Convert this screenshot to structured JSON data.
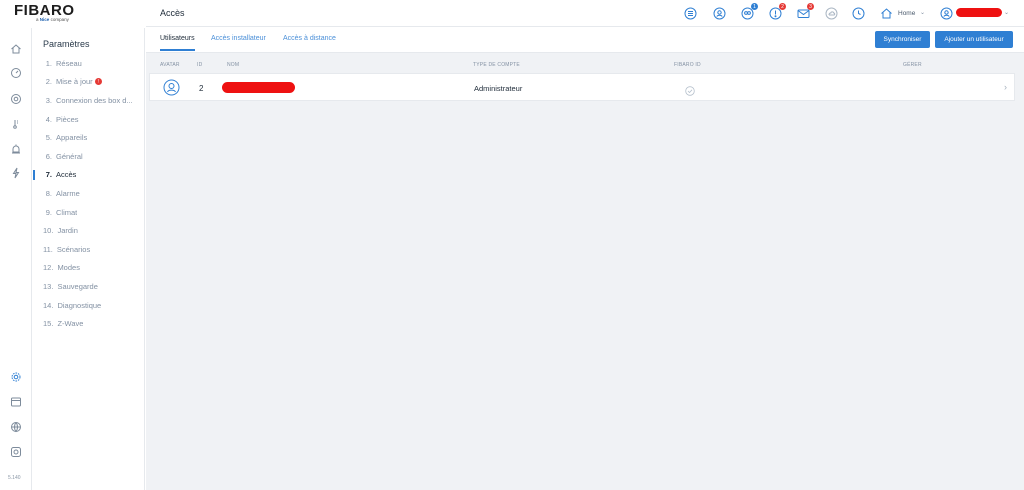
{
  "logo": {
    "brand": "FIBARO",
    "tagline_prefix": "a",
    "tagline_brand": "Nice",
    "tagline_suffix": "company"
  },
  "version": "5.140",
  "settings_menu": {
    "title": "Paramètres",
    "items": [
      {
        "num": "1.",
        "label": "Réseau"
      },
      {
        "num": "2.",
        "label": "Mise à jour",
        "badge": "!"
      },
      {
        "num": "3.",
        "label": "Connexion des box d..."
      },
      {
        "num": "4.",
        "label": "Pièces"
      },
      {
        "num": "5.",
        "label": "Appareils"
      },
      {
        "num": "6.",
        "label": "Général"
      },
      {
        "num": "7.",
        "label": "Accès",
        "active": true
      },
      {
        "num": "8.",
        "label": "Alarme"
      },
      {
        "num": "9.",
        "label": "Climat"
      },
      {
        "num": "10.",
        "label": "Jardin"
      },
      {
        "num": "11.",
        "label": "Scénarios"
      },
      {
        "num": "12.",
        "label": "Modes"
      },
      {
        "num": "13.",
        "label": "Sauvegarde"
      },
      {
        "num": "14.",
        "label": "Diagnostique"
      },
      {
        "num": "15.",
        "label": "Z-Wave"
      }
    ]
  },
  "header": {
    "title": "Accès",
    "badges": {
      "users": "1",
      "notifications": "2",
      "messages": "3"
    },
    "home_label": "Home"
  },
  "tabs": [
    {
      "label": "Utilisateurs",
      "active": true
    },
    {
      "label": "Accès installateur"
    },
    {
      "label": "Accès à distance"
    }
  ],
  "buttons": {
    "sync": "Synchroniser",
    "add_user": "Ajouter un utilisateur"
  },
  "table": {
    "columns": {
      "avatar": "AVATAR",
      "id": "ID",
      "name": "NOM",
      "account_type": "TYPE DE COMPTE",
      "fibaro_id": "FIBARO ID",
      "manage": "GÉRER"
    },
    "rows": [
      {
        "id": "2",
        "account_type": "Administrateur"
      }
    ]
  },
  "colors": {
    "accent": "#2f7fd3",
    "badge_red": "#e53935",
    "badge_blue": "#2f7fd3",
    "redaction": "#ee1111",
    "content_bg": "#f0f2f5"
  }
}
